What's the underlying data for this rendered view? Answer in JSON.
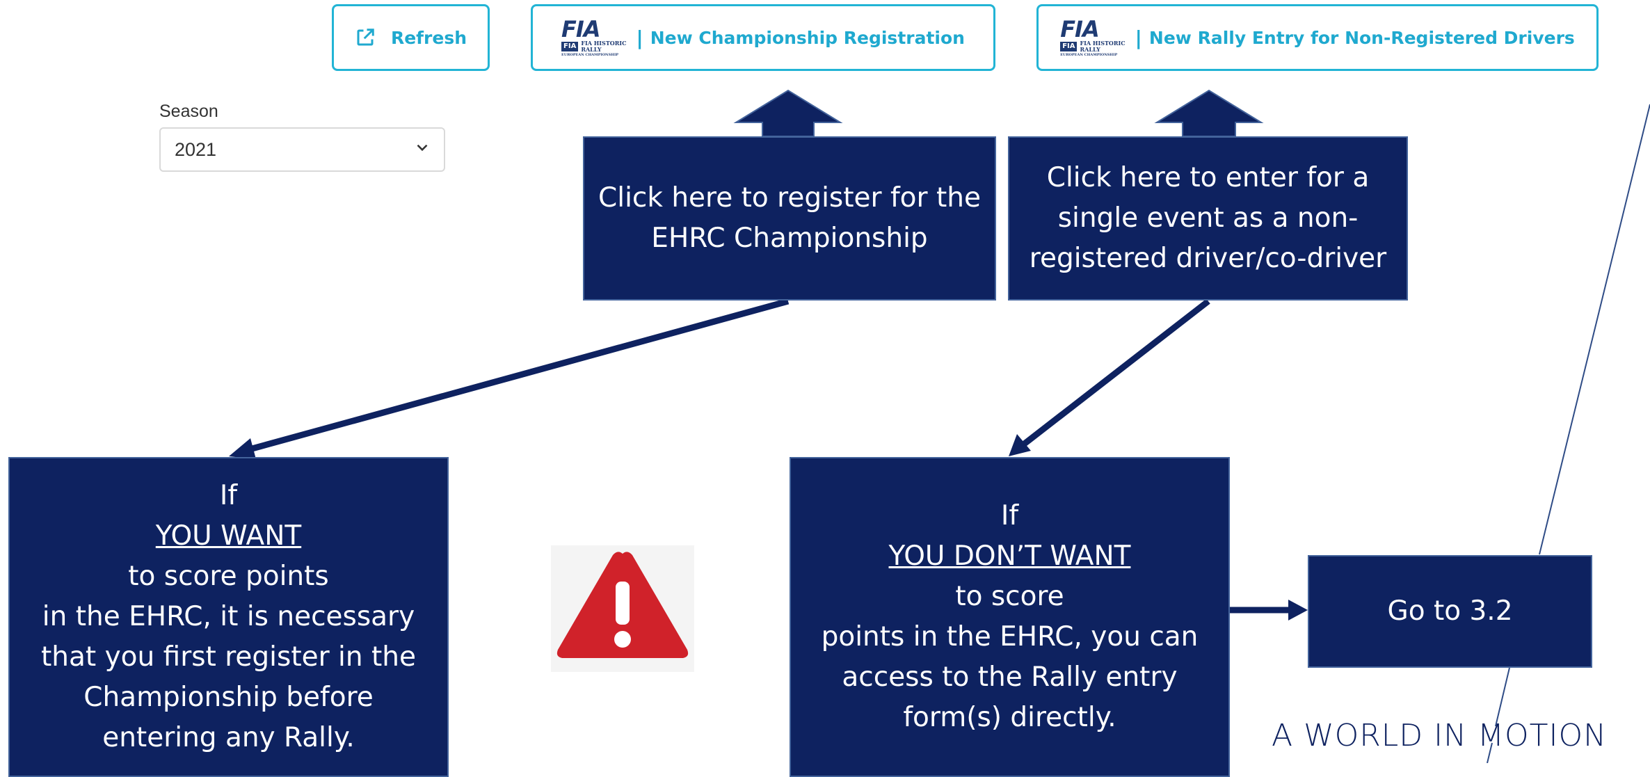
{
  "toolbar": {
    "refresh_label": "Refresh",
    "championship_label": "New Championship Registration",
    "rally_entry_label": "New Rally Entry for Non-Registered Drivers",
    "logo": {
      "mark": "FIA",
      "small": "FIA",
      "line1": "FIA HISTORIC",
      "line2": "RALLY",
      "line3": "EUROPEAN CHAMPIONSHIP"
    }
  },
  "season": {
    "label": "Season",
    "value": "2021"
  },
  "callouts": {
    "register": {
      "line1": "Click here to register for the",
      "line2": "EHRC Championship"
    },
    "single_event": {
      "line1": "Click here to enter for a",
      "line2": "single event as a non-",
      "line3": "registered driver/co-driver"
    },
    "want": {
      "pre": "If ",
      "emph": "YOU WANT",
      "post": " to score points",
      "line2": "in the EHRC, it is necessary",
      "line3": "that you first register in the",
      "line4": "Championship before",
      "line5": "entering any Rally."
    },
    "dont_want": {
      "pre": "If ",
      "emph": "YOU DON’T WANT",
      "post": " to score",
      "line2": "points in the EHRC, you can",
      "line3": "access to the Rally entry",
      "line4": "form(s) directly."
    },
    "goto": {
      "label": "Go to 3.2"
    }
  },
  "footer": {
    "tagline": "A WORLD IN MOTION"
  },
  "colors": {
    "navy": "#0e2260",
    "cyan": "#22b4d5",
    "warning_red": "#d0222a"
  }
}
